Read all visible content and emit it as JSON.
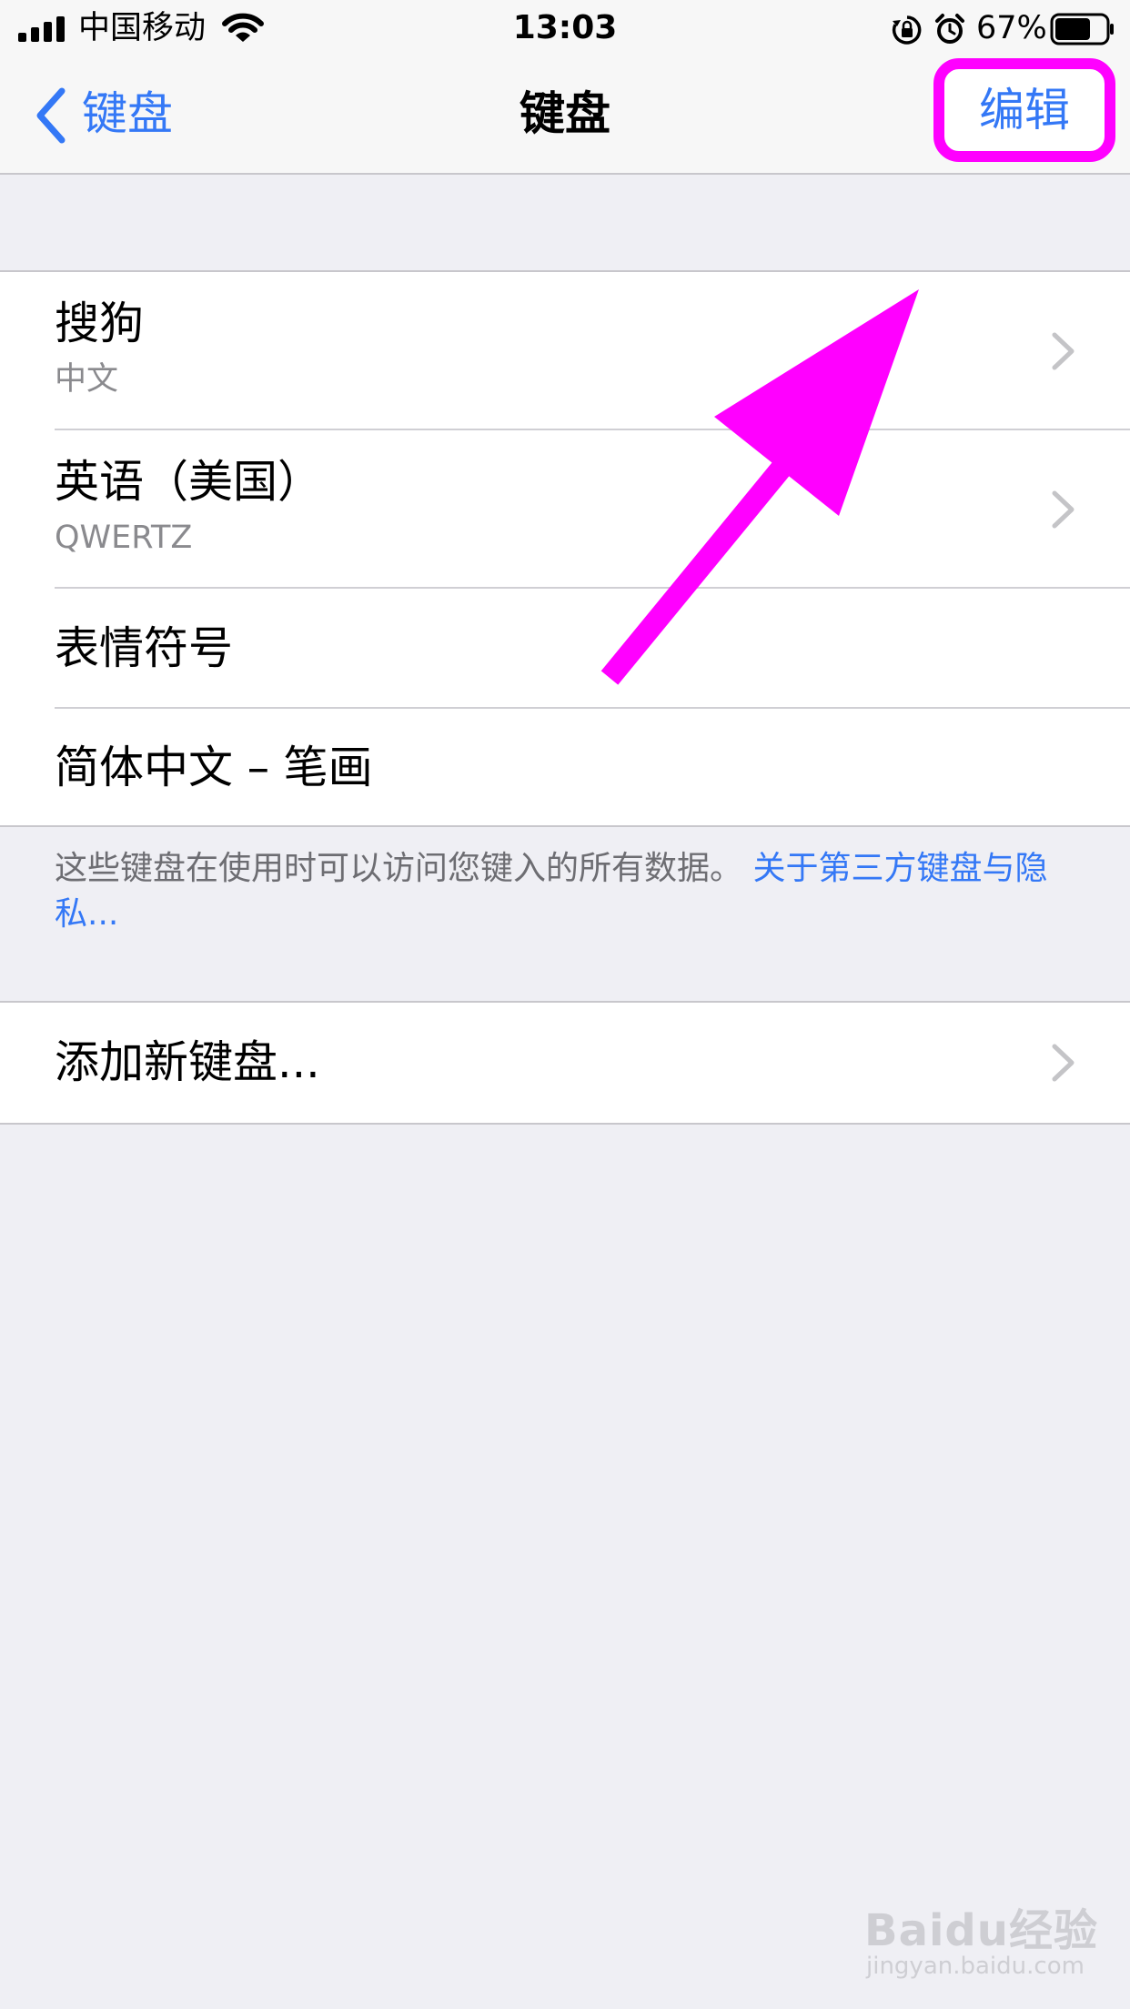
{
  "status_bar": {
    "carrier": "中国移动",
    "time": "13:03",
    "battery": "67%"
  },
  "nav": {
    "back_label": "键盘",
    "title": "键盘",
    "edit_label": "编辑"
  },
  "keyboards": [
    {
      "title": "搜狗",
      "subtitle": "中文"
    },
    {
      "title": "英语（美国）",
      "subtitle": "QWERTZ"
    },
    {
      "title": "表情符号"
    },
    {
      "title": "简体中文 – 笔画"
    }
  ],
  "footer": {
    "text": "这些键盘在使用时可以访问您键入的所有数据。 ",
    "link": "关于第三方键盘与隐私..."
  },
  "add_keyboard": {
    "label": "添加新键盘..."
  },
  "watermark": {
    "logo": "Baidu经验",
    "url": "jingyan.baidu.com"
  },
  "colors": {
    "accent": "#3478f6",
    "highlight": "#ff00ff",
    "background": "#efeff4"
  }
}
